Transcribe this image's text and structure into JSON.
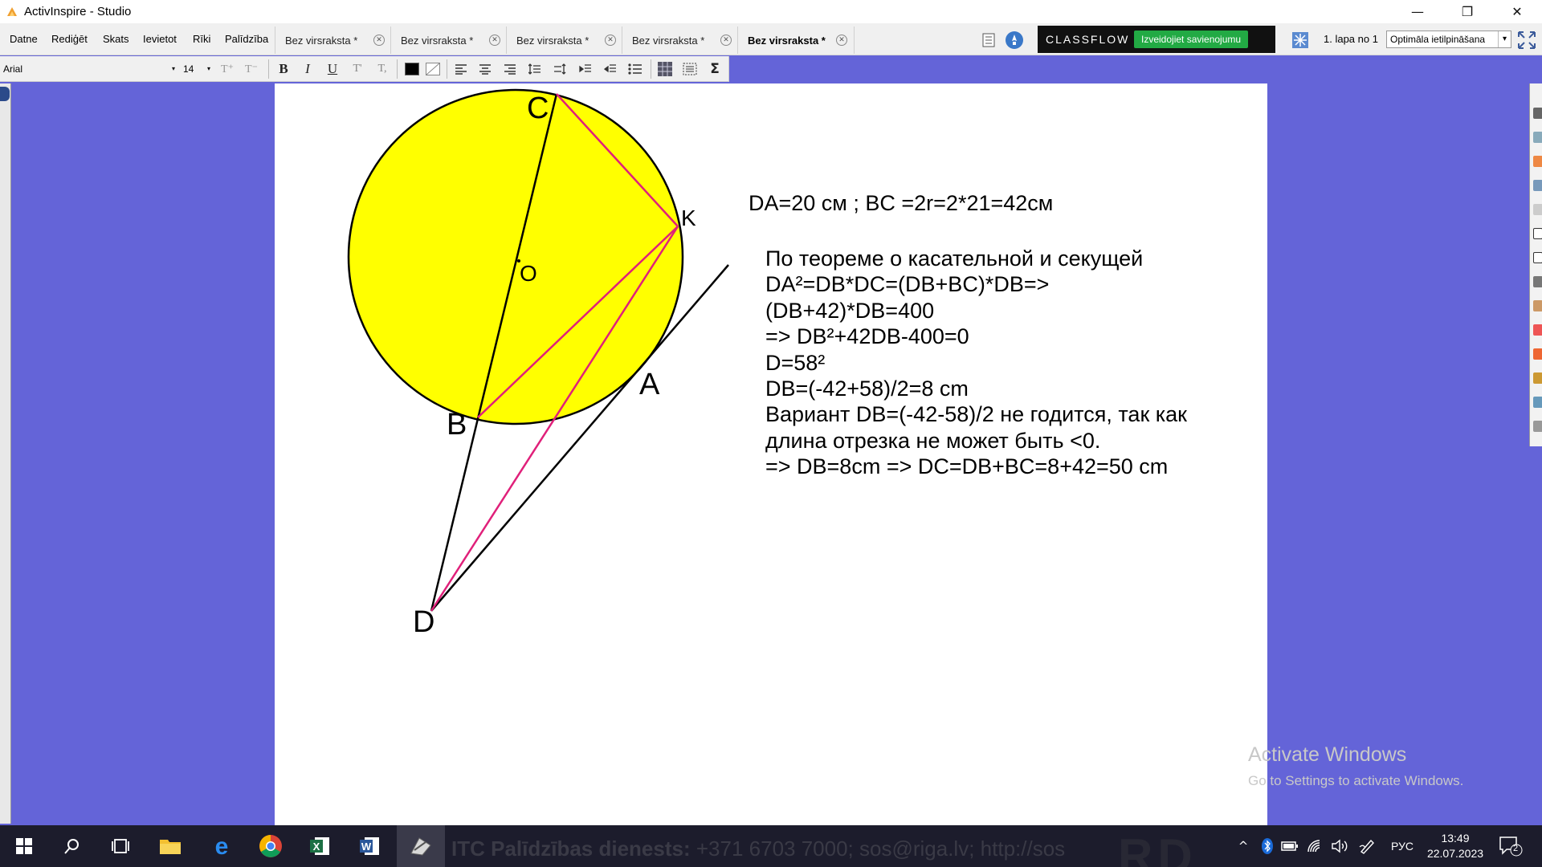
{
  "window": {
    "title": "ActivInspire - Studio",
    "minimize": "—",
    "restore": "❐",
    "close": "✕"
  },
  "menu": [
    "Datne",
    "Rediģēt",
    "Skats",
    "Ievietot",
    "Rīki",
    "Palīdzība"
  ],
  "tabs": [
    {
      "label": "Bez virsraksta *",
      "active": false
    },
    {
      "label": "Bez virsraksta *",
      "active": false
    },
    {
      "label": "Bez virsraksta *",
      "active": false
    },
    {
      "label": "Bez virsraksta *",
      "active": false
    },
    {
      "label": "Bez virsraksta *",
      "active": true
    }
  ],
  "tab_close_glyph": "✕",
  "classflow": {
    "logo": "CLASSFLOW",
    "button": "Izveidojiet savienojumu"
  },
  "page_indicator": "1. lapa no 1",
  "zoom": {
    "value": "Optimāla ietilpināšana",
    "chevron": "▾"
  },
  "format_toolbar": {
    "font": "Arial",
    "size": "14",
    "chevron": "▾",
    "bold": "B",
    "italic": "I",
    "underline": "U",
    "superscript": "T'",
    "subscript": "T,",
    "sigma": "Σ"
  },
  "canvas": {
    "labels": {
      "C": "C",
      "K": "K",
      "O": "O",
      "A": "A",
      "B": "B",
      "D": "D"
    },
    "given": "DA=20 см ;   BC =2r=2*21=42см",
    "solution": [
      "По теореме о касательной и секущей",
      "DA²=DB*DC=(DB+BC)*DB=>",
      "(DB+42)*DB=400",
      "=> DB²+42DB-400=0",
      "D=58²",
      "DB=(-42+58)/2=8 cm",
      "Вариант DB=(-42-58)/2 не годится, так как",
      "длина отрезка не может быть <0.",
      "=> DB=8cm => DC=DB+BC=8+42=50 cm"
    ],
    "colors": {
      "circle_fill": "#ffff00",
      "pink": "#e0207a",
      "line": "#000000"
    }
  },
  "watermark": {
    "title": "Activate Windows",
    "subtitle": "Go to Settings to activate Windows."
  },
  "taskbar": {
    "marquee_bold": "ITC Palīdzības dienests:",
    "marquee_rest": " +371 6703 7000; sos@riga.lv; http://sos",
    "rd_logo": "RD",
    "tray_chevron": "^",
    "language": "РУС",
    "time": "13:49",
    "date": "22.07.2023",
    "notifications": "2"
  }
}
